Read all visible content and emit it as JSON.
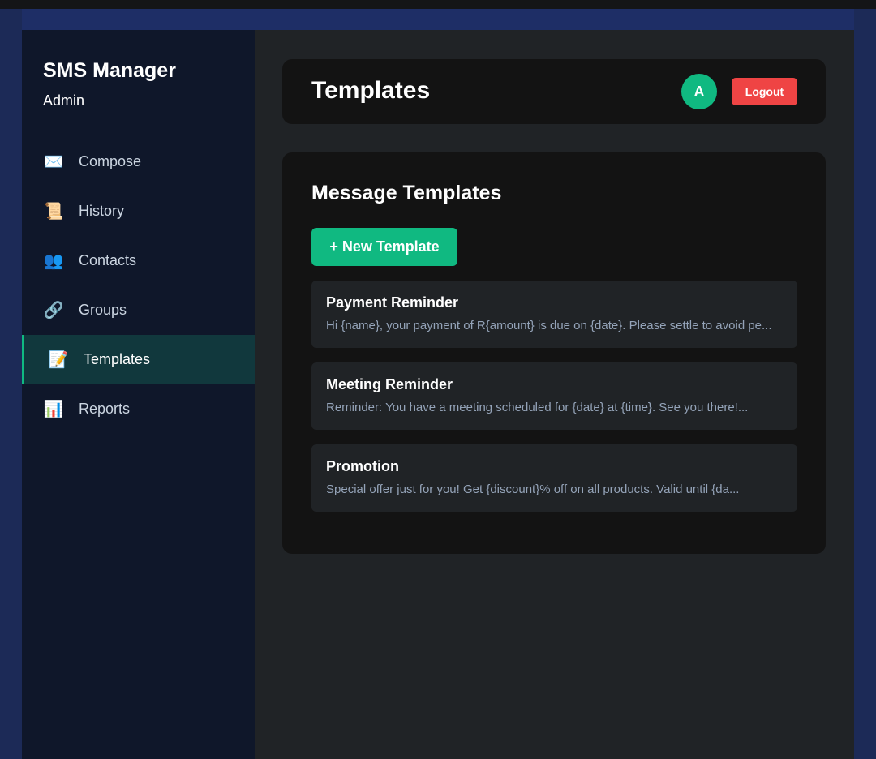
{
  "sidebar": {
    "title": "SMS Manager",
    "subtitle": "Admin",
    "items": [
      {
        "label": "Compose",
        "icon": "✉️",
        "icon_name": "envelope-icon"
      },
      {
        "label": "History",
        "icon": "📜",
        "icon_name": "scroll-icon"
      },
      {
        "label": "Contacts",
        "icon": "👥",
        "icon_name": "people-icon"
      },
      {
        "label": "Groups",
        "icon": "🔗",
        "icon_name": "link-icon"
      },
      {
        "label": "Templates",
        "icon": "📝",
        "icon_name": "memo-icon"
      },
      {
        "label": "Reports",
        "icon": "📊",
        "icon_name": "bar-chart-icon"
      }
    ],
    "active_index": 4
  },
  "header": {
    "title": "Templates",
    "avatar_initial": "A",
    "logout_label": "Logout"
  },
  "main": {
    "section_title": "Message Templates",
    "new_button_label": "+ New Template",
    "templates": [
      {
        "name": "Payment Reminder",
        "preview": "Hi {name}, your payment of R{amount} is due on {date}. Please settle to avoid pe..."
      },
      {
        "name": "Meeting Reminder",
        "preview": "Reminder: You have a meeting scheduled for {date} at {time}. See you there!..."
      },
      {
        "name": "Promotion",
        "preview": "Special offer just for you! Get {discount}% off on all products. Valid until {da..."
      }
    ]
  },
  "colors": {
    "accent": "#10b981",
    "danger": "#ef4444",
    "sidebar_bg": "#0f172a",
    "active_bg": "#11383d"
  }
}
